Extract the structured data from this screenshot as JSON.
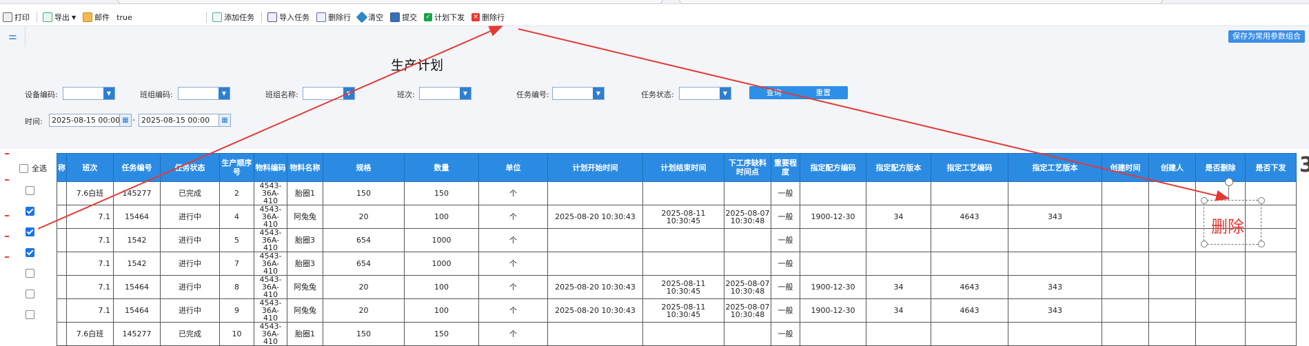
{
  "toolbar": {
    "print": "打印",
    "export": "导出",
    "mail": "邮件",
    "value": "true",
    "add_task": "添加任务",
    "import_task": "导入任务",
    "delete_row": "删除行",
    "clear": "清空",
    "submit": "提交",
    "plan_dispatch": "计划下发",
    "delete_row_2": "删除行"
  },
  "filter_bar": {
    "save_combo": "保存为常用参数组合"
  },
  "form": {
    "title": "生产计划",
    "device_code_label": "设备编码:",
    "team_code_label": "班组编码:",
    "team_name_label": "班组名称:",
    "shift_label": "班次:",
    "task_no_label": "任务编号:",
    "task_status_label": "任务状态:",
    "query_button": "查询",
    "reset_button": "重置",
    "time_label": "时间:",
    "date_from": "2025-08-15 00:00",
    "date_sep": "-",
    "date_to": "2025-08-15 00:00"
  },
  "grid": {
    "select_all": "全选",
    "columns": [
      "称",
      "班次",
      "任务编号",
      "任务状态",
      "生产顺序号",
      "物料编码",
      "物料名称",
      "规格",
      "数量",
      "单位",
      "计划开始时间",
      "计划结束时间",
      "下工序缺料时间点",
      "重要程度",
      "指定配方编码",
      "指定配方版本",
      "指定工艺编码",
      "指定工艺版本",
      "创建时间",
      "创建人",
      "是否删除",
      "是否下发"
    ],
    "rows": [
      {
        "checked": false,
        "cells": [
          "",
          "7.6白班",
          "145277",
          "已完成",
          "2",
          "4543-36A-410",
          "胎圈1",
          "150",
          "150",
          "个",
          "",
          "",
          "",
          "一般",
          "",
          "",
          "",
          "",
          "",
          "",
          "",
          ""
        ]
      },
      {
        "checked": true,
        "cells": [
          "",
          "7.1",
          "15464",
          "进行中",
          "4",
          "4543-36A-410",
          "阿兔兔",
          "20",
          "100",
          "个",
          "2025-08-20 10:30:43",
          "2025-08-11 10:30:45",
          "2025-08-07 10:30:48",
          "一般",
          "1900-12-30",
          "34",
          "4643",
          "343",
          "",
          "",
          "",
          ""
        ]
      },
      {
        "checked": true,
        "cells": [
          "",
          "7.1",
          "1542",
          "进行中",
          "5",
          "4543-36A-410",
          "胎圈3",
          "654",
          "1000",
          "个",
          "",
          "",
          "",
          "一般",
          "",
          "",
          "",
          "",
          "",
          "",
          "",
          ""
        ]
      },
      {
        "checked": true,
        "cells": [
          "",
          "7.1",
          "1542",
          "进行中",
          "7",
          "4543-36A-410",
          "胎圈3",
          "654",
          "1000",
          "个",
          "",
          "",
          "",
          "一般",
          "",
          "",
          "",
          "",
          "",
          "",
          "",
          ""
        ]
      },
      {
        "checked": false,
        "cells": [
          "",
          "7.1",
          "15464",
          "进行中",
          "8",
          "4543-36A-410",
          "阿兔兔",
          "20",
          "100",
          "个",
          "2025-08-20 10:30:43",
          "2025-08-11 10:30:45",
          "2025-08-07 10:30:48",
          "一般",
          "1900-12-30",
          "34",
          "4643",
          "343",
          "",
          "",
          "",
          ""
        ]
      },
      {
        "checked": false,
        "cells": [
          "",
          "7.1",
          "15464",
          "进行中",
          "9",
          "4543-36A-410",
          "阿兔兔",
          "20",
          "100",
          "个",
          "2025-08-20 10:30:43",
          "2025-08-11 10:30:45",
          "2025-08-07 10:30:48",
          "一般",
          "1900-12-30",
          "34",
          "4643",
          "343",
          "",
          "",
          "",
          ""
        ]
      },
      {
        "checked": false,
        "cells": [
          "",
          "7.6白班",
          "145277",
          "已完成",
          "10",
          "4543-36A-410",
          "胎圈1",
          "150",
          "150",
          "个",
          "",
          "",
          "",
          "一般",
          "",
          "",
          "",
          "",
          "",
          "",
          "",
          ""
        ]
      }
    ]
  },
  "annotation": {
    "label": "删除"
  },
  "right_edge": {
    "glyph": "3"
  },
  "colors": {
    "accent": "#2b8be2",
    "arrow": "#e53935"
  }
}
